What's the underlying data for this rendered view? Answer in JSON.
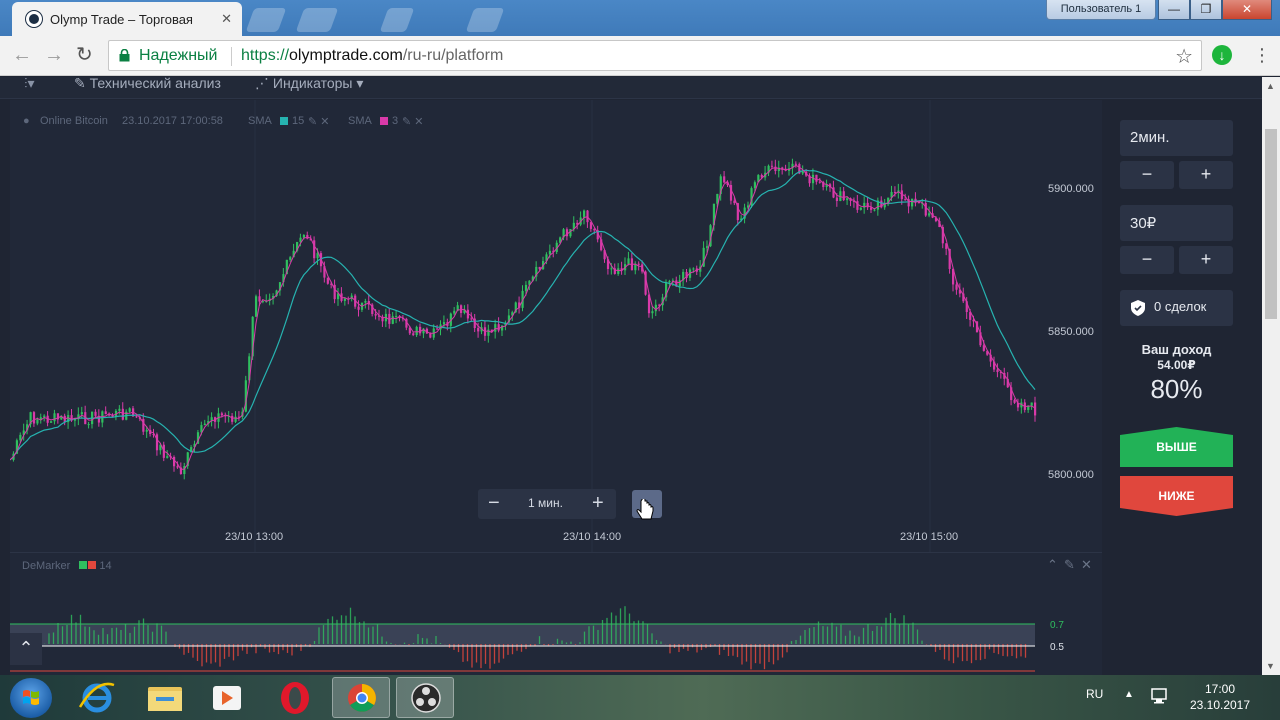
{
  "browser": {
    "tab_title": "Olymp Trade – Торговая",
    "tab_close": "✕",
    "user_button": "Пользователь 1",
    "security_label": "Надежный",
    "url_scheme": "https://",
    "url_host": "olymptrade.com",
    "url_path": "/ru-ru/platform"
  },
  "toolbar": {
    "technical_analysis": "Технический анализ",
    "indicators": "Индикаторы"
  },
  "chart": {
    "legend_asset": "Online Bitcoin",
    "legend_datetime": "23.10.2017 17:00:58",
    "sma1_label": "SMA",
    "sma1_period": "15",
    "sma1_color": "#26b3b0",
    "sma2_label": "SMA",
    "sma2_period": "3",
    "sma2_color": "#d93aa9",
    "price_labels": [
      "5900.000",
      "5850.000",
      "5800.000"
    ],
    "time_labels": [
      "23/10 13:00",
      "23/10 14:00",
      "23/10 15:00"
    ],
    "zoom_label": "1 мин.",
    "zoom_minus": "−",
    "zoom_plus": "+",
    "forward": "›"
  },
  "oscillator": {
    "name": "DeMarker",
    "period": "14",
    "levels": [
      "0.7",
      "0.5"
    ],
    "color_up": "#2fbf5f",
    "color_down": "#e0473d"
  },
  "trade": {
    "duration": "2мин.",
    "amount": "30₽",
    "minus": "−",
    "plus": "+",
    "deals": "0 сделок",
    "income_label": "Ваш доход",
    "income_value": "54.00₽",
    "payout": "80%",
    "up_label": "ВЫШЕ",
    "down_label": "НИЖЕ",
    "up_color": "#22b257",
    "down_color": "#e0473d"
  },
  "taskbar": {
    "language": "RU",
    "time": "17:00",
    "date": "23.10.2017",
    "apps": [
      "internet-explorer-icon",
      "file-explorer-icon",
      "media-player-icon",
      "opera-icon",
      "chrome-icon",
      "obs-icon"
    ]
  }
}
